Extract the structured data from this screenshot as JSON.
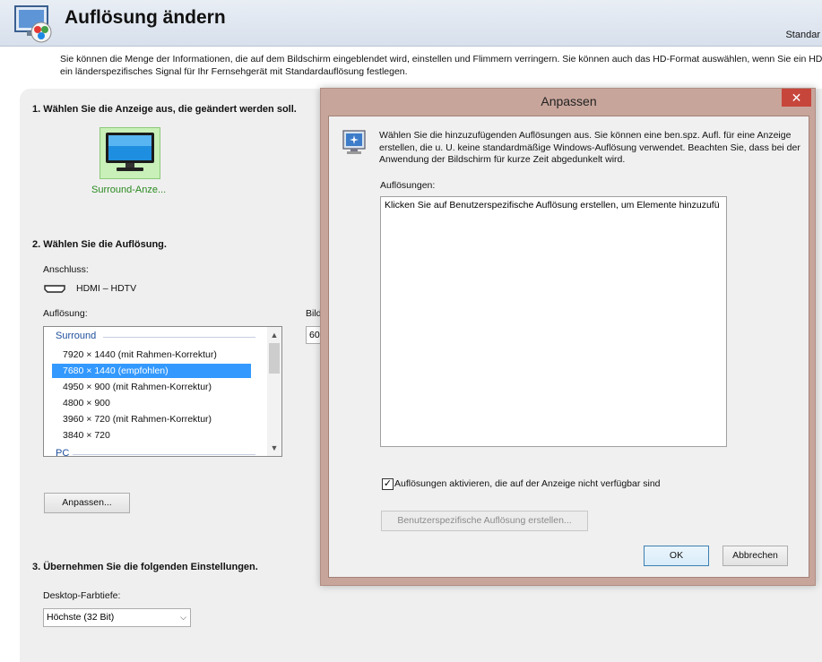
{
  "header": {
    "title": "Auflösung ändern",
    "right_text": "Standar",
    "intro_line1": "Sie können die Menge der Informationen, die auf dem Bildschirm eingeblendet wird, einstellen und Flimmern verringern. Sie können auch das HD-Format auswählen, wenn Sie ein HD",
    "intro_line2": "ein länderspezifisches Signal für Ihr Fernsehgerät mit Standardauflösung festlegen."
  },
  "step1": {
    "heading": "1. Wählen Sie die Anzeige aus, die geändert werden soll.",
    "display_name": "Surround-Anze..."
  },
  "step2": {
    "heading": "2. Wählen Sie die Auflösung.",
    "connection_label": "Anschluss:",
    "connection_value": "HDMI – HDTV",
    "resolution_label": "Auflösung:",
    "refresh_label_partial": "Bild",
    "refresh_value_partial": "60",
    "list": {
      "group_surround": "Surround",
      "items": [
        "7920 × 1440 (mit Rahmen-Korrektur)",
        "7680 × 1440 (empfohlen)",
        "4950 × 900 (mit Rahmen-Korrektur)",
        "4800 × 900",
        "3960 × 720 (mit Rahmen-Korrektur)",
        "3840 × 720"
      ],
      "selected_index": 1,
      "group_pc": "PC"
    },
    "customize_button": "Anpassen..."
  },
  "step3": {
    "heading": "3. Übernehmen Sie die folgenden Einstellungen.",
    "depth_label": "Desktop-Farbtiefe:",
    "depth_value": "Höchste (32 Bit)"
  },
  "dialog": {
    "title": "Anpassen",
    "close_glyph": "✕",
    "description": "Wählen Sie die hinzuzufügenden Auflösungen aus. Sie können eine ben.spz. Aufl. für eine Anzeige erstellen, die u. U. keine standardmäßige Windows-Auflösung verwendet. Beachten Sie, dass bei der Anwendung der Bildschirm für kurze Zeit abgedunkelt wird.",
    "resolutions_label": "Auflösungen:",
    "resolutions_placeholder": "Klicken Sie auf Benutzerspezifische Auflösung erstellen, um Elemente hinzuzufü",
    "checkbox_label": "Auflösungen aktivieren, die auf der Anzeige nicht verfügbar sind",
    "checkbox_checked": true,
    "checkmark": "✓",
    "create_button": "Benutzerspezifische Auflösung erstellen...",
    "ok_button": "OK",
    "cancel_button": "Abbrechen"
  },
  "colors": {
    "selection": "#3399ff",
    "dialog_frame": "#c8a59b",
    "close_button": "#c7463c",
    "display_tile": "#c8f0b8",
    "group_text": "#1e4e9c"
  },
  "icons": [
    "display-settings-icon",
    "monitor-icon",
    "hdmi-connector-icon",
    "info-monitor-icon",
    "close-icon",
    "chevron-down-icon",
    "chevron-up-icon"
  ]
}
